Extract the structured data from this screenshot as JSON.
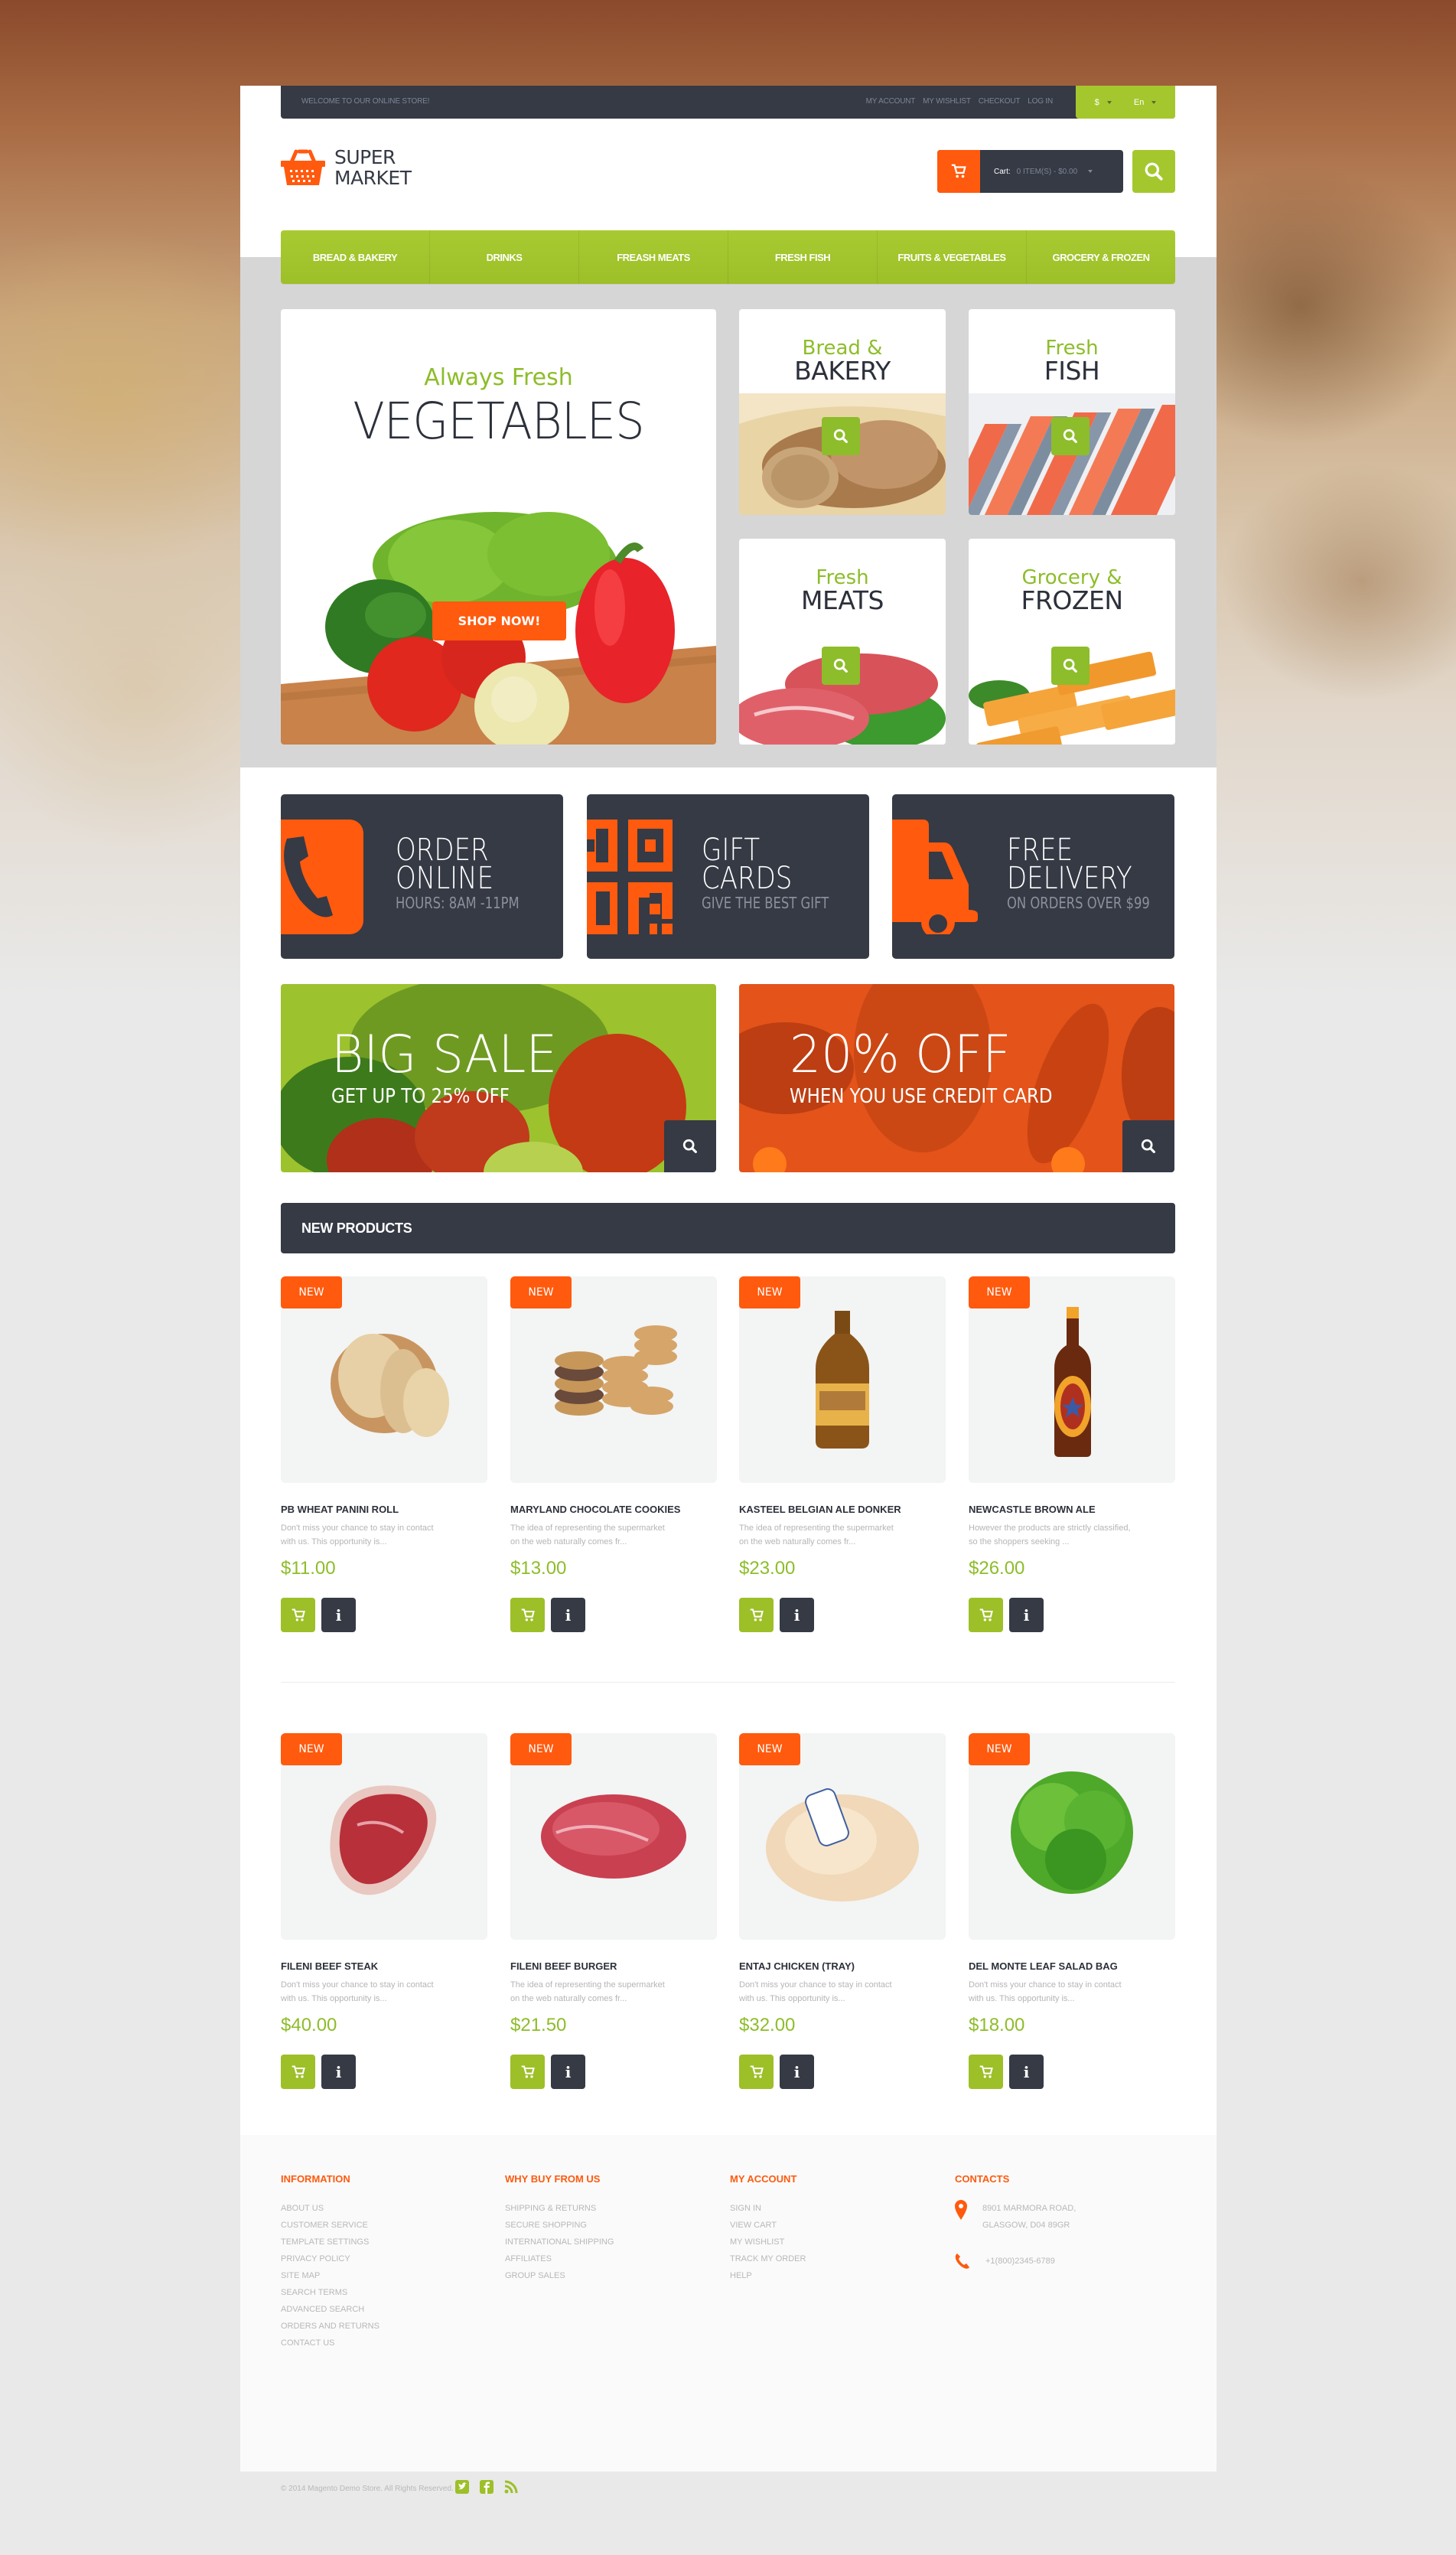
{
  "topbar": {
    "welcome": "WELCOME TO OUR ONLINE STORE!",
    "links": [
      "MY ACCOUNT",
      "MY WISHLIST",
      "CHECKOUT",
      "LOG IN"
    ],
    "currency": "$",
    "language": "En"
  },
  "logo": {
    "line1": "SUPER",
    "line2": "MARKET"
  },
  "cart": {
    "label": "Cart:",
    "summary": "0 ITEM(S) - $0.00"
  },
  "nav": [
    "BREAD & BAKERY",
    "DRINKS",
    "FREASH MEATS",
    "FRESH FISH",
    "FRUITS & VEGETABLES",
    "GROCERY & FROZEN"
  ],
  "hero": {
    "kicker": "Always Fresh",
    "title": "VEGETABLES",
    "cta": "SHOP NOW!"
  },
  "categories": [
    {
      "kicker": "Bread &",
      "title": "BAKERY"
    },
    {
      "kicker": "Fresh",
      "title": "FISH"
    },
    {
      "kicker": "Fresh",
      "title": "MEATS"
    },
    {
      "kicker": "Grocery &",
      "title": "FROZEN"
    }
  ],
  "features": [
    {
      "line1": "ORDER",
      "line2": "ONLINE",
      "sub": "HOURS: 8AM -11PM",
      "icon": "phone-icon"
    },
    {
      "line1": "GIFT",
      "line2": "CARDS",
      "sub": "GIVE THE BEST GIFT",
      "icon": "qr-code-icon"
    },
    {
      "line1": "FREE",
      "line2": "DELIVERY",
      "sub": "ON ORDERS OVER $99",
      "icon": "truck-icon"
    }
  ],
  "banners": [
    {
      "title": "BIG SALE",
      "sub": "GET UP TO 25% OFF"
    },
    {
      "title": "20% OFF",
      "sub": "WHEN YOU USE CREDIT CARD"
    }
  ],
  "new_products": {
    "heading": "NEW PRODUCTS",
    "badge": "NEW",
    "items": [
      {
        "name": "PB WHEAT PANINI ROLL",
        "desc": "Don't miss your chance to stay in contact with us. This opportunity is...",
        "price": "$11.00"
      },
      {
        "name": "MARYLAND CHOCOLATE COOKIES",
        "desc": "The idea of representing the supermarket on the web naturally comes fr...",
        "price": "$13.00"
      },
      {
        "name": "KASTEEL BELGIAN ALE DONKER",
        "desc": "The idea of representing the supermarket on the web naturally comes fr...",
        "price": "$23.00"
      },
      {
        "name": "NEWCASTLE BROWN ALE",
        "desc": "However the products are strictly classified, so the shoppers seeking ...",
        "price": "$26.00"
      },
      {
        "name": "FILENI BEEF STEAK",
        "desc": "Don't miss your chance to stay in contact with us. This opportunity is...",
        "price": "$40.00"
      },
      {
        "name": "FILENI BEEF BURGER",
        "desc": "The idea of representing the supermarket on the web naturally comes fr...",
        "price": "$21.50"
      },
      {
        "name": "ENTAJ CHICKEN (TRAY)",
        "desc": "Don't miss your chance to stay in contact with us. This opportunity is...",
        "price": "$32.00"
      },
      {
        "name": "DEL MONTE LEAF SALAD BAG",
        "desc": "Don't miss your chance to stay in contact with us. This opportunity is...",
        "price": "$18.00"
      }
    ]
  },
  "footer": {
    "information": {
      "heading": "INFORMATION",
      "links": [
        "ABOUT US",
        "CUSTOMER SERVICE",
        "TEMPLATE SETTINGS",
        "PRIVACY POLICY",
        "SITE MAP",
        "SEARCH TERMS",
        "ADVANCED SEARCH",
        "ORDERS AND RETURNS",
        "CONTACT US"
      ]
    },
    "why_buy": {
      "heading": "WHY BUY FROM US",
      "links": [
        "SHIPPING & RETURNS",
        "SECURE SHOPPING",
        "INTERNATIONAL SHIPPING",
        "AFFILIATES",
        "GROUP SALES"
      ]
    },
    "my_account": {
      "heading": "MY ACCOUNT",
      "links": [
        "SIGN IN",
        "VIEW CART",
        "MY WISHLIST",
        "TRACK MY ORDER",
        "HELP"
      ]
    },
    "contacts": {
      "heading": "CONTACTS",
      "address_line1": "8901 MARMORA ROAD,",
      "address_line2": "GLASGOW, D04 89GR",
      "phone": "+1(800)2345-6789"
    },
    "copyright": "© 2014 Magento Demo Store. All Rights Reserved.",
    "socials": [
      "twitter-icon",
      "facebook-icon",
      "rss-icon"
    ]
  },
  "colors": {
    "accent_green": "#a5c72e",
    "accent_orange": "#ff5a0e",
    "dark": "#353a45"
  }
}
